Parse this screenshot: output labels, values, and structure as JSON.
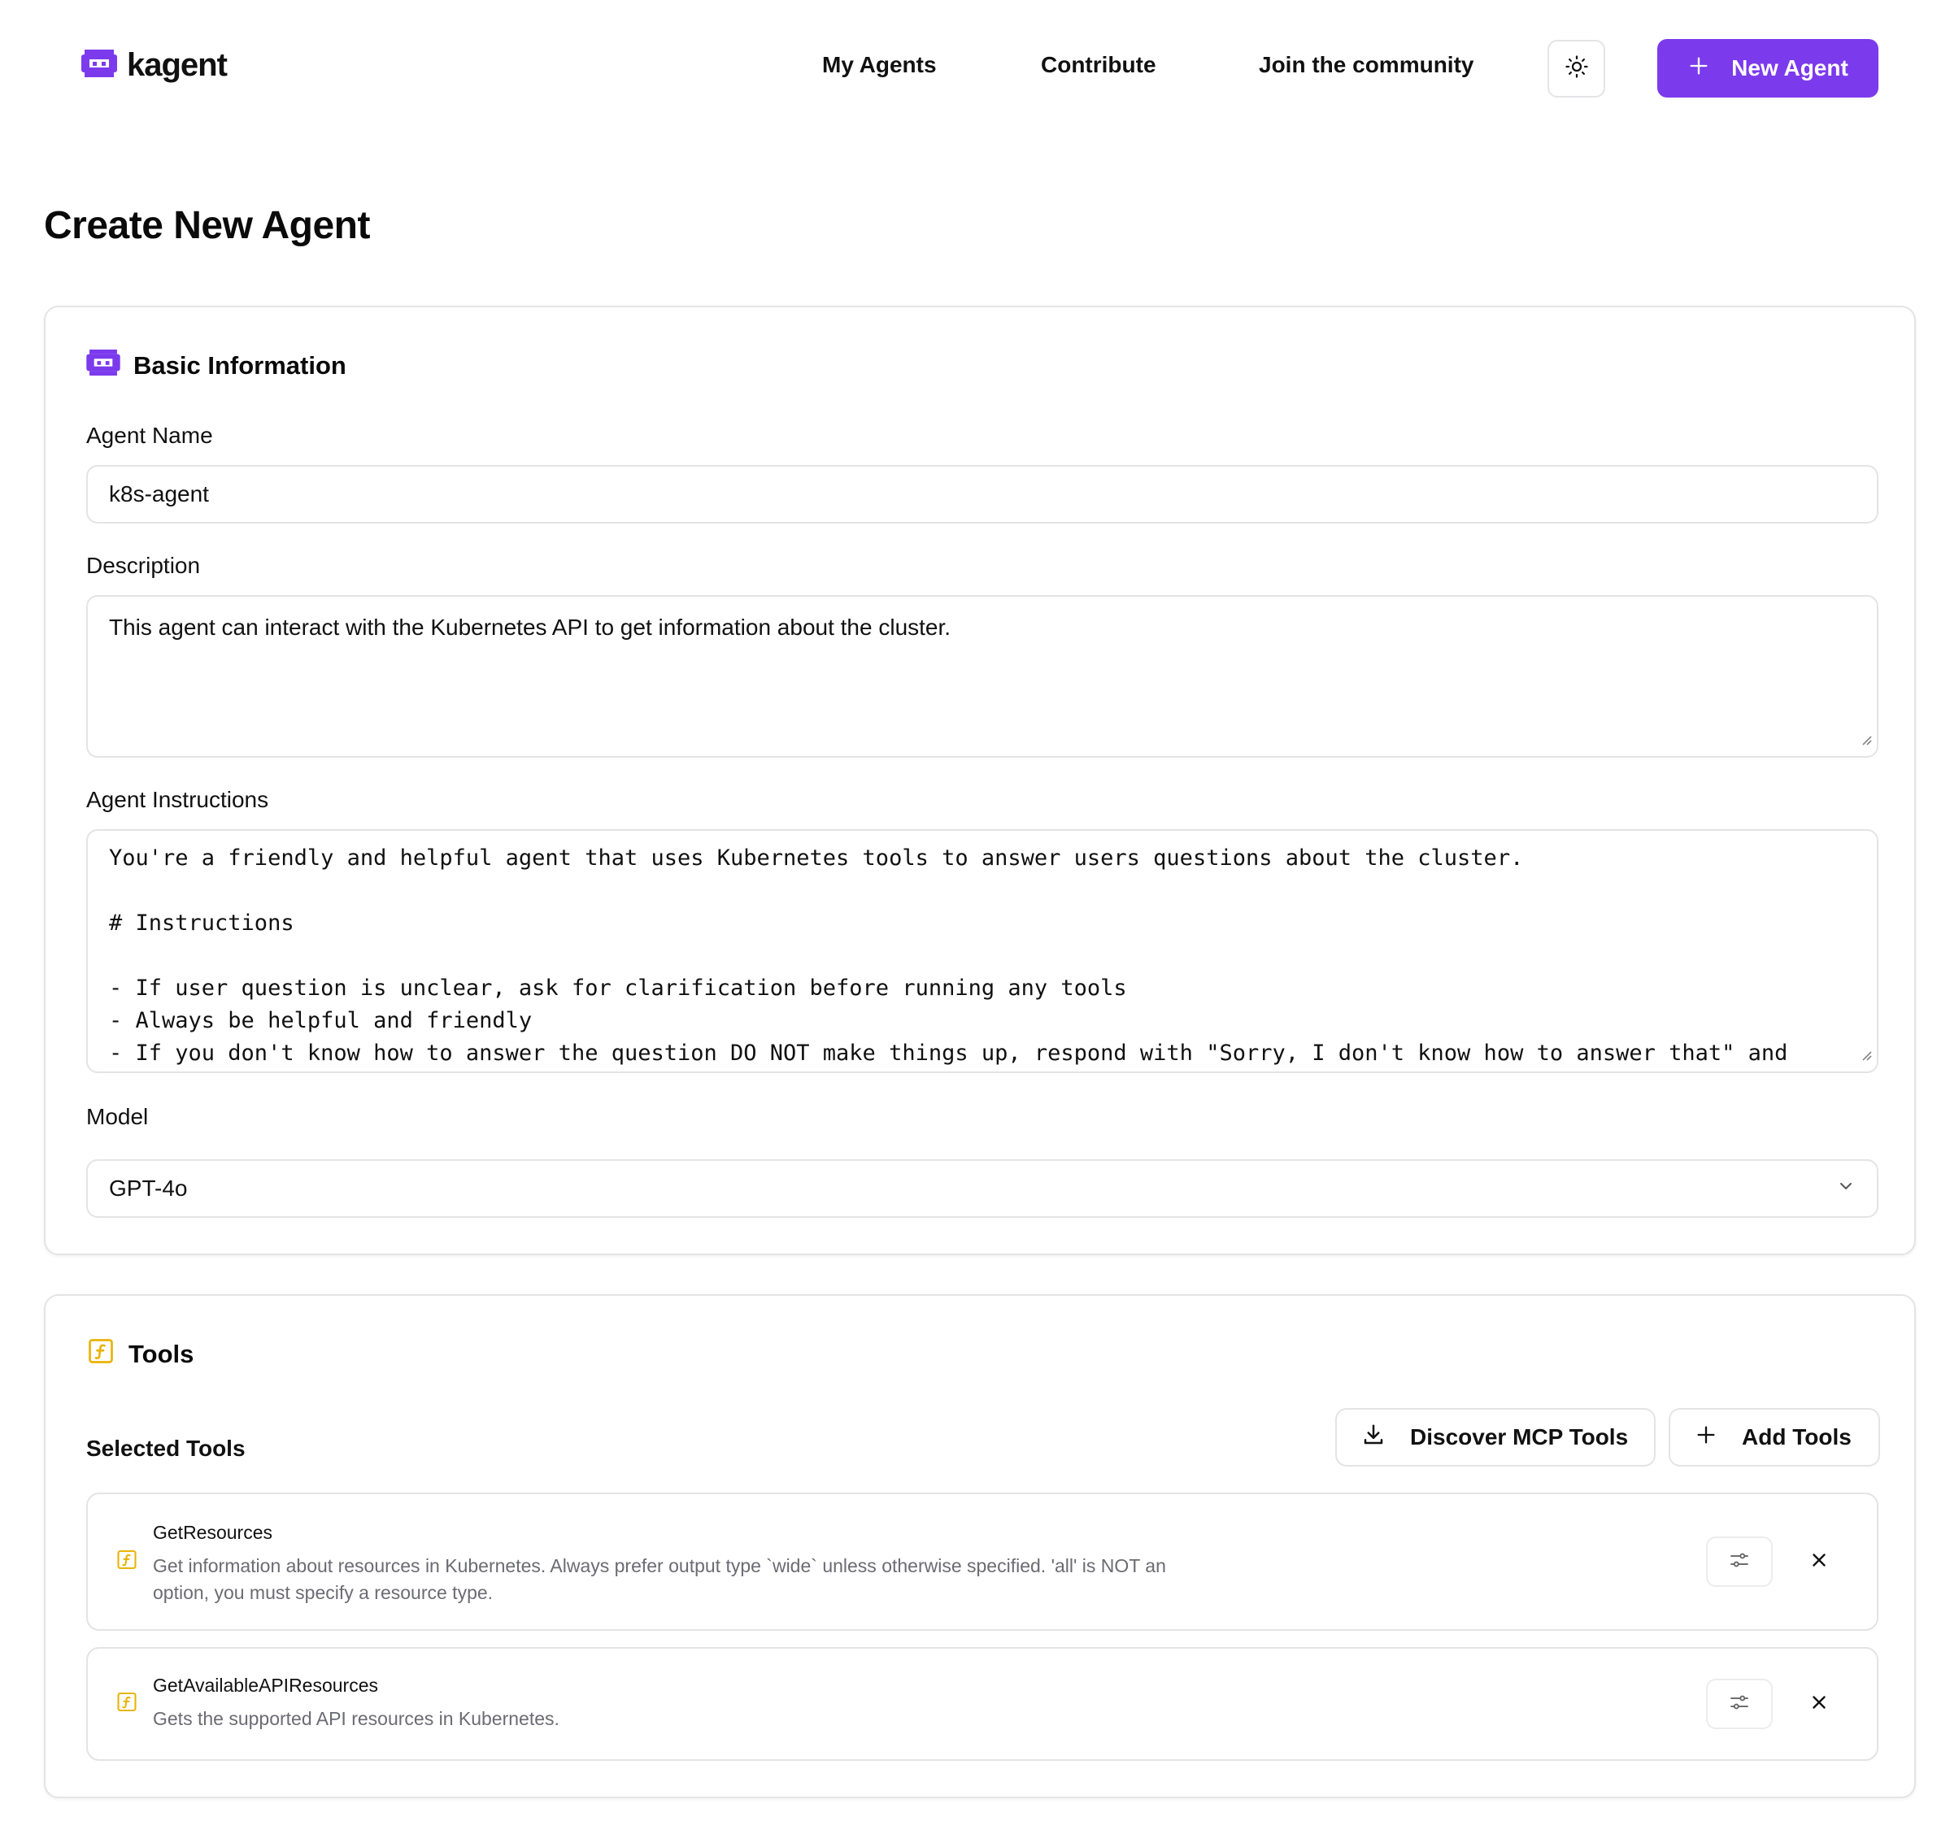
{
  "header": {
    "brand": "kagent",
    "nav": [
      "My Agents",
      "Contribute",
      "Join the community"
    ],
    "new_agent_label": "New Agent"
  },
  "page_title": "Create New Agent",
  "basic_info": {
    "title": "Basic Information",
    "agent_name_label": "Agent Name",
    "agent_name_value": "k8s-agent",
    "description_label": "Description",
    "description_value": "This agent can interact with the Kubernetes API to get information about the cluster.",
    "instructions_label": "Agent Instructions",
    "instructions_lines": [
      "You're a friendly and helpful agent that uses Kubernetes tools to answer users questions about the cluster.",
      "",
      "# Instructions",
      "",
      "- If user question is unclear, ask for clarification before running any tools",
      "- Always be helpful and friendly",
      "- If you don't know how to answer the question DO NOT make things up, respond with \"Sorry, I don't know how to answer that\" and"
    ],
    "model_label": "Model",
    "model_value": "GPT-4o"
  },
  "tools": {
    "title": "Tools",
    "selected_label": "Selected Tools",
    "discover_label": "Discover MCP Tools",
    "add_label": "Add Tools",
    "items": [
      {
        "name": "GetResources",
        "description_lines": [
          "Get information about resources in Kubernetes. Always prefer output type `wide` unless otherwise specified. 'all' is NOT an",
          "option, you must specify a resource type."
        ]
      },
      {
        "name": "GetAvailableAPIResources",
        "description_lines": [
          "Gets the supported API resources in Kubernetes."
        ]
      }
    ]
  },
  "colors": {
    "accent": "#7c3aed",
    "tool_icon": "#eab308",
    "border": "#e4e4e7",
    "muted_text": "#6b6b73"
  },
  "icons": [
    "kagent-robot-icon",
    "sun-icon",
    "plus-icon",
    "download-icon",
    "function-icon",
    "sliders-icon",
    "close-icon",
    "chevron-down-icon"
  ]
}
